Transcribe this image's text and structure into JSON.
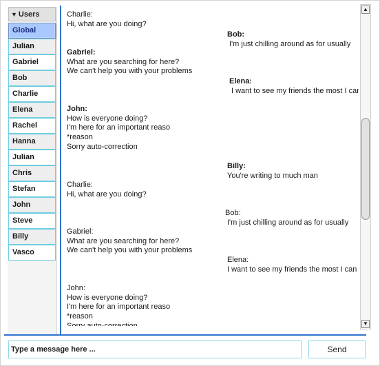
{
  "sidebar": {
    "header": "Users",
    "header_icon": "triangle-down-icon",
    "items": [
      {
        "label": "Global",
        "selected": true
      },
      {
        "label": "Julian"
      },
      {
        "label": "Gabriel"
      },
      {
        "label": "Bob"
      },
      {
        "label": "Charlie"
      },
      {
        "label": "Elena"
      },
      {
        "label": "Rachel"
      },
      {
        "label": "Hanna"
      },
      {
        "label": "Julian"
      },
      {
        "label": "Chris"
      },
      {
        "label": "Stefan"
      },
      {
        "label": "John"
      },
      {
        "label": "Steve"
      },
      {
        "label": "Billy"
      },
      {
        "label": "Vasco"
      }
    ]
  },
  "messages": [
    {
      "name": "Charlie:",
      "bold": false,
      "lines": [
        "Hi, what are you doing?"
      ]
    },
    {
      "name": "Bob:",
      "bold": true,
      "lines": [
        "I'm just chilling around as for usually"
      ]
    },
    {
      "name": "Gabriel:",
      "bold": true,
      "lines": [
        "What are you searching for here?",
        "We can't help you with your problems"
      ]
    },
    {
      "name": "Elena:",
      "bold": true,
      "lines": [
        "I want to see my friends the most I can"
      ]
    },
    {
      "name": "John:",
      "bold": true,
      "lines": [
        "How is everyone doing?",
        "I'm here for an important reaso",
        "*reason",
        "Sorry auto-correction"
      ]
    },
    {
      "name": "Billy:",
      "bold": true,
      "lines": [
        "You're writing to much man"
      ]
    },
    {
      "name": "Charlie:",
      "bold": false,
      "lines": [
        "Hi, what are you doing?"
      ]
    },
    {
      "name": "Bob:",
      "bold": false,
      "lines": [
        "I'm just chilling around as for usually"
      ]
    },
    {
      "name": "Gabriel:",
      "bold": false,
      "lines": [
        "What are you searching for here?",
        "We can't help you with your problems"
      ]
    },
    {
      "name": "Elena:",
      "bold": false,
      "lines": [
        "I want to see my friends the most I can"
      ]
    },
    {
      "name": "John:",
      "bold": false,
      "lines": [
        "How is everyone doing?",
        "I'm here for an important reaso",
        "*reason",
        "Sorry auto-correction"
      ]
    }
  ],
  "composer": {
    "placeholder": "Type a message here ...",
    "send_label": "Send"
  },
  "scrollbar": {
    "up_icon": "arrow-up-icon",
    "down_icon": "arrow-down-icon"
  },
  "colors": {
    "accent": "#2e74d0",
    "selected_bg": "#a9c8ff",
    "item_border": "#6ccde0"
  }
}
